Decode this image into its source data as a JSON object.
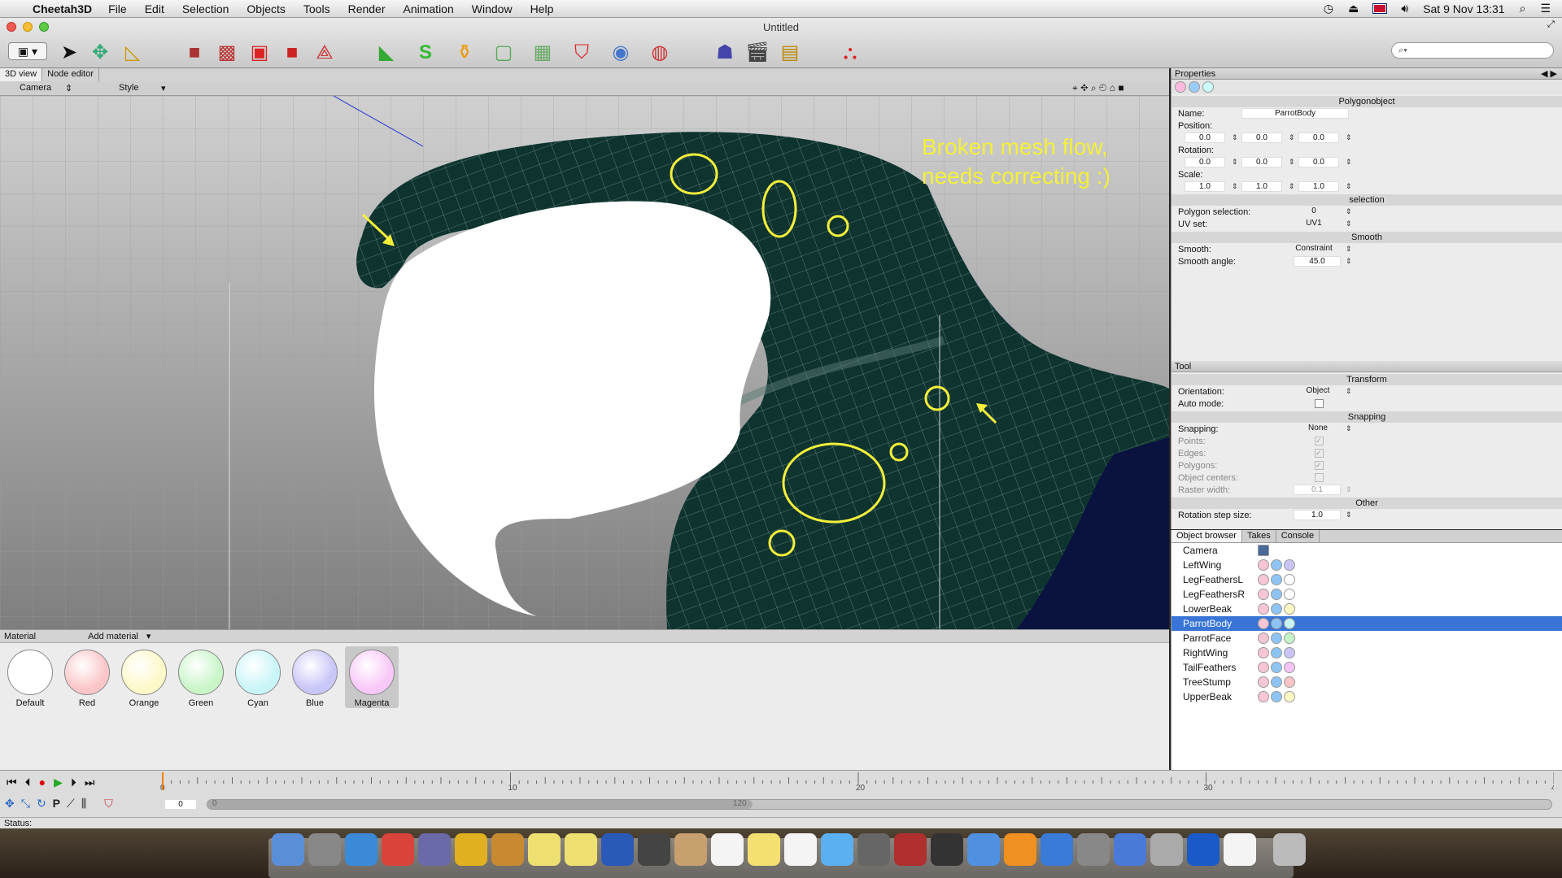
{
  "menubar": {
    "app_name": "Cheetah3D",
    "items": [
      "File",
      "Edit",
      "Selection",
      "Objects",
      "Tools",
      "Render",
      "Animation",
      "Window",
      "Help"
    ],
    "clock": "Sat 9 Nov  13:31"
  },
  "window": {
    "title": "Untitled"
  },
  "viewport": {
    "tabs": [
      "3D view",
      "Node editor"
    ],
    "camera_label": "Camera",
    "style_label": "Style",
    "annotation_line1": "Broken mesh flow,",
    "annotation_line2": "needs correcting :)",
    "annotation_color": "#f4f03a",
    "mesh_color": "#0f3430"
  },
  "properties": {
    "header": "Properties",
    "object_type": "Polygonobject",
    "name_label": "Name:",
    "name_value": "ParrotBody",
    "position_label": "Position:",
    "position": [
      "0.0",
      "0.0",
      "0.0"
    ],
    "rotation_label": "Rotation:",
    "rotation": [
      "0.0",
      "0.0",
      "0.0"
    ],
    "scale_label": "Scale:",
    "scale": [
      "1.0",
      "1.0",
      "1.0"
    ],
    "section_selection": "selection",
    "poly_sel_label": "Polygon selection:",
    "poly_sel_value": "0",
    "uvset_label": "UV set:",
    "uvset_value": "UV1",
    "section_smooth": "Smooth",
    "smooth_label": "Smooth:",
    "smooth_value": "Constraint",
    "smooth_angle_label": "Smooth angle:",
    "smooth_angle_value": "45.0"
  },
  "tool": {
    "header": "Tool",
    "section_transform": "Transform",
    "orientation_label": "Orientation:",
    "orientation_value": "Object",
    "automode_label": "Auto mode:",
    "section_snapping": "Snapping",
    "snapping_label": "Snapping:",
    "snapping_value": "None",
    "points_label": "Points:",
    "edges_label": "Edges:",
    "polygons_label": "Polygons:",
    "objcenters_label": "Object centers:",
    "raster_label": "Raster width:",
    "raster_value": "0.1",
    "section_other": "Other",
    "rotstep_label": "Rotation step size:",
    "rotstep_value": "1.0"
  },
  "objbrowser": {
    "tabs": [
      "Object browser",
      "Takes",
      "Console"
    ],
    "objects": [
      "Camera",
      "LeftWing",
      "LegFeathersL",
      "LegFeathersR",
      "LowerBeak",
      "ParrotBody",
      "ParrotFace",
      "RightWing",
      "TailFeathers",
      "TreeStump",
      "UpperBeak"
    ],
    "selected": "ParrotBody",
    "material_tag_colors": [
      "",
      "#c8c4f4",
      "#ffffff",
      "#ffffff",
      "#fdf8c4",
      "#c8f4f6",
      "#c4f4c8",
      "#c8c4f4",
      "#f4c4f4",
      "#f8c4c8",
      "#fdf8c4"
    ]
  },
  "materials": {
    "label": "Material",
    "add_label": "Add material",
    "items": [
      {
        "name": "Default",
        "color": "#ffffff"
      },
      {
        "name": "Red",
        "color": "#fbc6c8"
      },
      {
        "name": "Orange",
        "color": "#fdf8c8"
      },
      {
        "name": "Green",
        "color": "#c9f5c9"
      },
      {
        "name": "Cyan",
        "color": "#c9f5f8"
      },
      {
        "name": "Blue",
        "color": "#c9c6f8"
      },
      {
        "name": "Magenta",
        "color": "#f8c8f8"
      }
    ],
    "selected": "Magenta"
  },
  "timeline": {
    "ticks": [
      "0",
      "10",
      "20",
      "30",
      "40"
    ],
    "frame_value": "0",
    "range_start": "0",
    "range_end": "120"
  },
  "status": {
    "label": "Status:"
  }
}
